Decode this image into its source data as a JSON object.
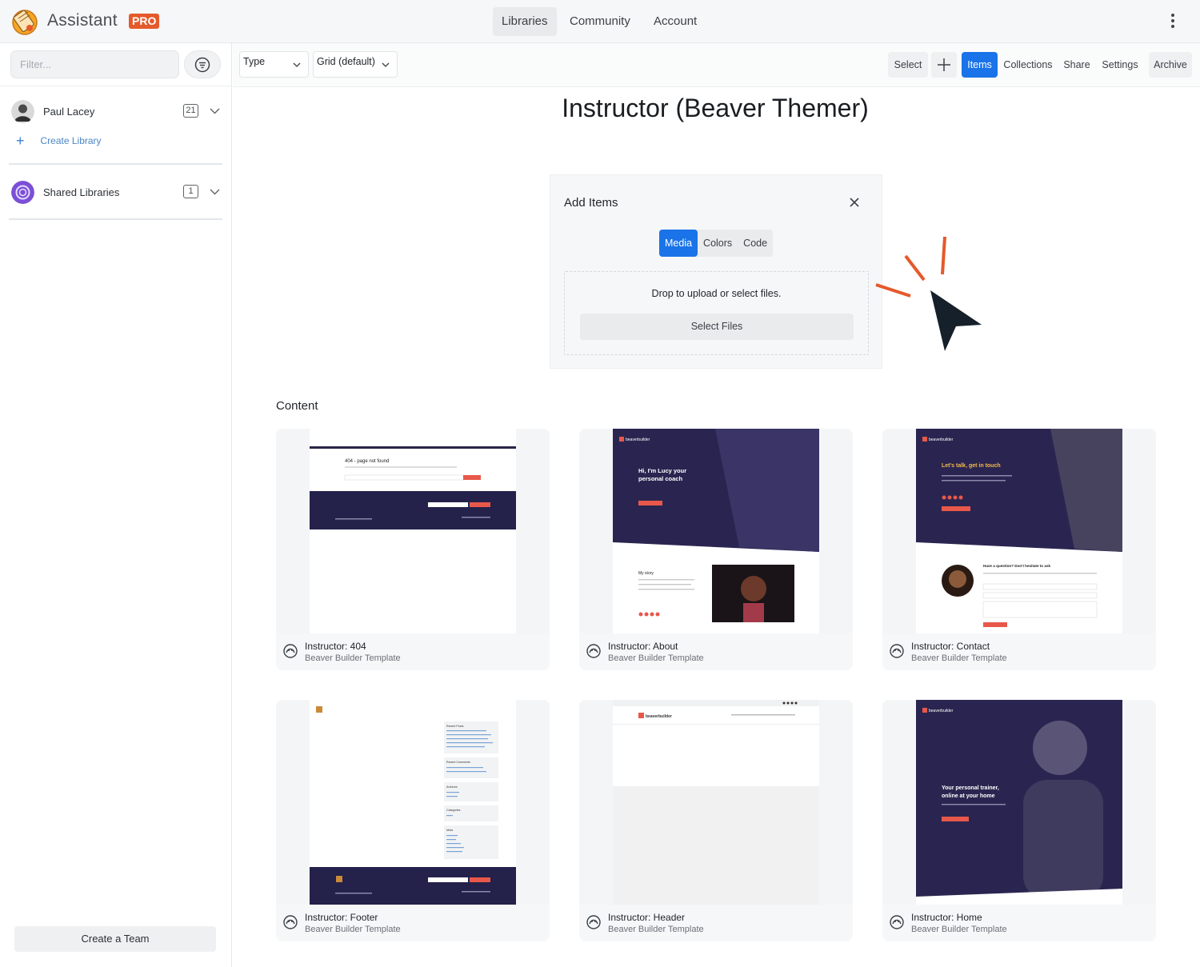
{
  "app": {
    "brand": "Assistant",
    "badge": "PRO",
    "nav": [
      "Libraries",
      "Community",
      "Account"
    ],
    "active_nav": "Libraries",
    "accent": "#1a73e8",
    "brand_orange": "#e5592b"
  },
  "sidebar": {
    "filter_placeholder": "Filter...",
    "libraries": [
      {
        "name": "Paul Lacey",
        "count": "21"
      },
      {
        "name": "Shared Libraries",
        "count": "1"
      }
    ],
    "create_library": "Create Library",
    "create_team": "Create a Team"
  },
  "toolbar": {
    "type_select": "Type",
    "view_select": "Grid (default)",
    "buttons": [
      "Select",
      "Items",
      "Collections",
      "Share",
      "Settings",
      "Archive"
    ],
    "active_button": "Items"
  },
  "main": {
    "title": "Instructor (Beaver Themer)",
    "add_items": {
      "title": "Add Items",
      "tabs": [
        "Media",
        "Colors",
        "Code"
      ],
      "active_tab": "Media",
      "drop_text": "Drop to upload or select files.",
      "select_files": "Select Files"
    },
    "section_title": "Content",
    "items": [
      {
        "title": "Instructor: 404",
        "subtitle": "Beaver Builder Template",
        "thumb_text": [
          "404 - page not found"
        ]
      },
      {
        "title": "Instructor: About",
        "subtitle": "Beaver Builder Template",
        "thumb_text": [
          "beaverbuilder",
          "Hi, I'm Lucy your",
          "personal coach",
          "My story"
        ]
      },
      {
        "title": "Instructor: Contact",
        "subtitle": "Beaver Builder Template",
        "thumb_text": [
          "beaverbuilder",
          "Let's talk, get in touch",
          "Have a question? Don't hesitate to ask"
        ]
      },
      {
        "title": "Instructor: Footer",
        "subtitle": "Beaver Builder Template",
        "thumb_text": [
          "Recent Posts",
          "Recent Comments",
          "Archives",
          "Categories",
          "Meta"
        ]
      },
      {
        "title": "Instructor: Header",
        "subtitle": "Beaver Builder Template",
        "thumb_text": [
          "beaverbuilder"
        ]
      },
      {
        "title": "Instructor: Home",
        "subtitle": "Beaver Builder Template",
        "thumb_text": [
          "beaverbuilder",
          "Your personal trainer,",
          "online at your home"
        ]
      }
    ]
  }
}
